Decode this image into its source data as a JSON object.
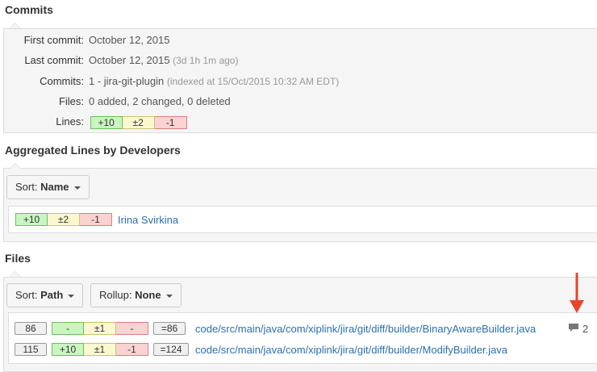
{
  "commits_section": {
    "title": "Commits",
    "first_commit": {
      "label": "First commit:",
      "value": "October 12, 2015"
    },
    "last_commit": {
      "label": "Last commit:",
      "value": "October 12, 2015",
      "note": "(3d 1h 1m ago)"
    },
    "commits": {
      "label": "Commits:",
      "value": "1 - jira-git-plugin",
      "note": "(indexed at 15/Oct/2015 10:32 AM EDT)"
    },
    "files": {
      "label": "Files:",
      "value": "0 added, 2 changed, 0 deleted"
    },
    "lines": {
      "label": "Lines:",
      "added": "+10",
      "changed": "±2",
      "deleted": "-1"
    }
  },
  "developers_section": {
    "title": "Aggregated Lines by Developers",
    "sort_label": "Sort:",
    "sort_value": "Name",
    "rows": [
      {
        "added": "+10",
        "changed": "±2",
        "deleted": "-1",
        "name": "Irina Svirkina"
      }
    ]
  },
  "files_section": {
    "title": "Files",
    "sort_label": "Sort:",
    "sort_value": "Path",
    "rollup_label": "Rollup:",
    "rollup_value": "None",
    "rows": [
      {
        "count": "86",
        "added": "-",
        "changed": "±1",
        "deleted": "-",
        "total": "=86",
        "path": "code/src/main/java/com/xiplink/jira/git/diff/builder/BinaryAwareBuilder.java",
        "comments": "2"
      },
      {
        "count": "115",
        "added": "+10",
        "changed": "±1",
        "deleted": "-1",
        "total": "=124",
        "path": "code/src/main/java/com/xiplink/jira/git/diff/builder/ModifyBuilder.java",
        "comments": ""
      }
    ]
  },
  "colors": {
    "link": "#2a6fb0",
    "added": "#c8f5c0",
    "changed": "#fbf8cf",
    "deleted": "#fad2d2",
    "arrow": "#e8462a"
  },
  "icons": {
    "comment": "comment-icon",
    "arrow": "red-arrow-icon",
    "caret": "caret-down-icon"
  }
}
